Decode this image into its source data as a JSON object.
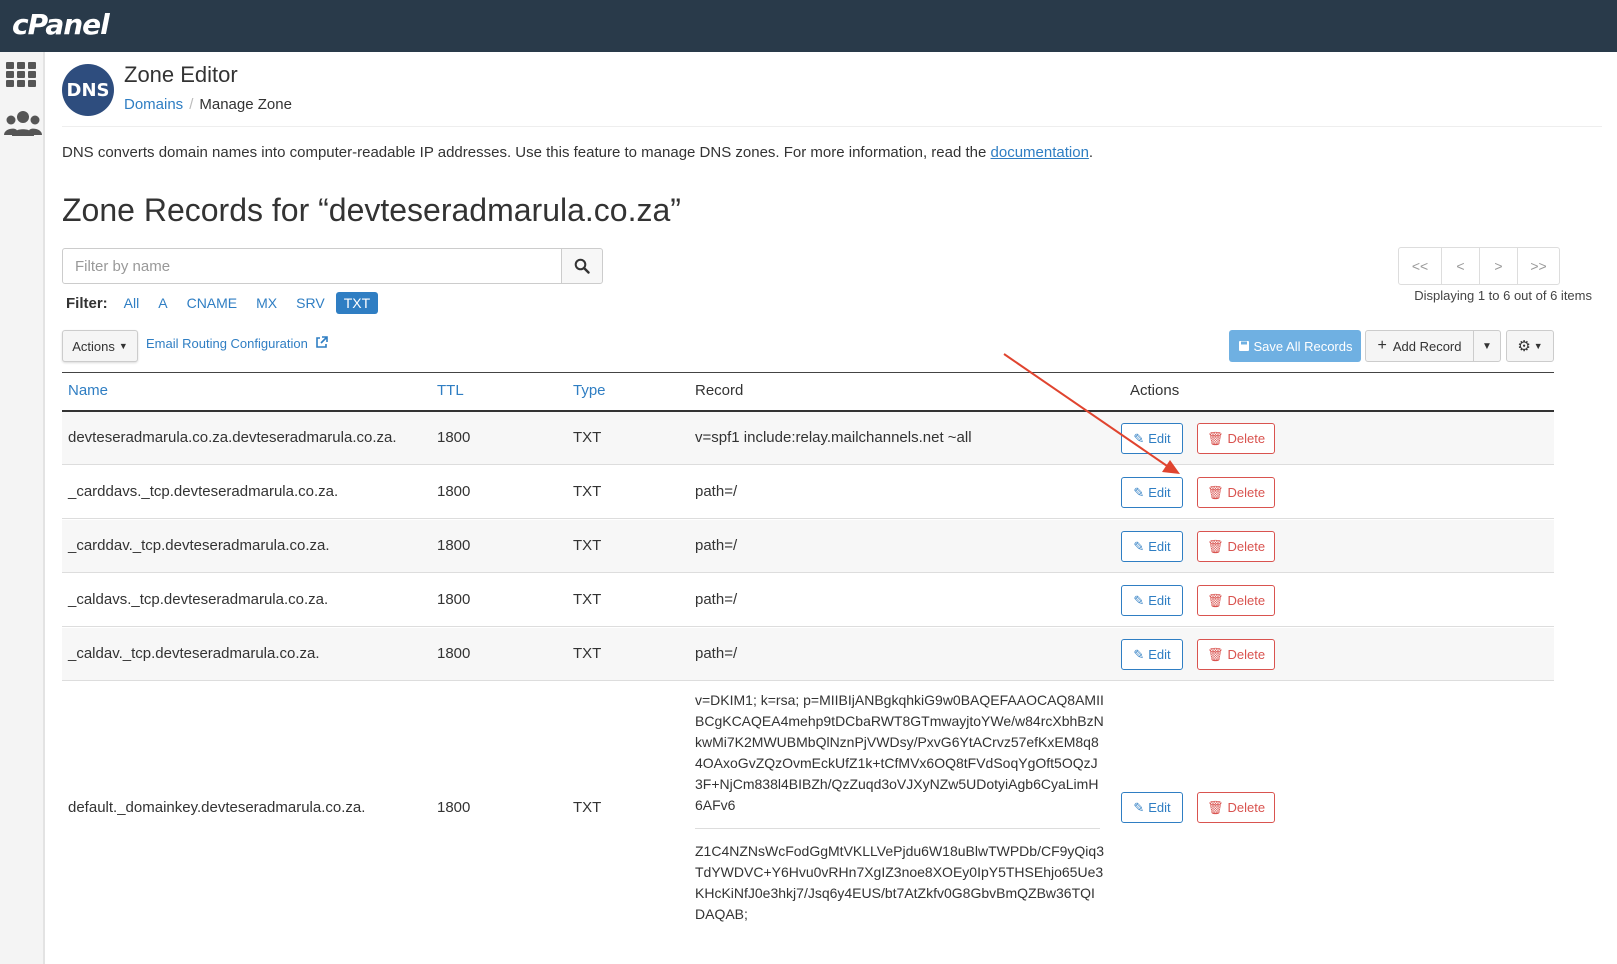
{
  "brand": {
    "logo_text": "cPanel"
  },
  "header": {
    "app_title": "Zone Editor",
    "dns_logo_text": "DNS",
    "breadcrumb": {
      "link": "Domains",
      "separator": "/",
      "current": "Manage Zone"
    }
  },
  "intro": {
    "text": "DNS converts domain names into computer-readable IP addresses. Use this feature to manage DNS zones. For more information, read the ",
    "link": "documentation",
    "suffix": "."
  },
  "zone_title": "Zone Records for “devteseradmarula.co.za”",
  "search": {
    "placeholder": "Filter by name"
  },
  "filter": {
    "label": "Filter:",
    "options": [
      "All",
      "A",
      "CNAME",
      "MX",
      "SRV",
      "TXT"
    ],
    "active": "TXT"
  },
  "pagination": {
    "buttons": [
      "<<",
      "<",
      ">",
      ">>"
    ],
    "info": "Displaying 1 to 6 out of 6 items"
  },
  "toolbar": {
    "actions_label": "Actions",
    "email_routing": "Email Routing Configuration",
    "save_all": "Save All Records",
    "add_record": "Add Record"
  },
  "table": {
    "headers": {
      "name": "Name",
      "ttl": "TTL",
      "type": "Type",
      "record": "Record",
      "actions": "Actions"
    },
    "edit_label": "Edit",
    "delete_label": "Delete",
    "rows": [
      {
        "name": "devteseradmarula.co.za.devteseradmarula.co.za.",
        "ttl": "1800",
        "type": "TXT",
        "record": "v=spf1 include:relay.mailchannels.net ~all"
      },
      {
        "name": "_carddavs._tcp.devteseradmarula.co.za.",
        "ttl": "1800",
        "type": "TXT",
        "record": "path=/"
      },
      {
        "name": "_carddav._tcp.devteseradmarula.co.za.",
        "ttl": "1800",
        "type": "TXT",
        "record": "path=/"
      },
      {
        "name": "_caldavs._tcp.devteseradmarula.co.za.",
        "ttl": "1800",
        "type": "TXT",
        "record": "path=/"
      },
      {
        "name": "_caldav._tcp.devteseradmarula.co.za.",
        "ttl": "1800",
        "type": "TXT",
        "record": "path=/"
      },
      {
        "name": "default._domainkey.devteseradmarula.co.za.",
        "ttl": "1800",
        "type": "TXT",
        "record_part1": "v=DKIM1; k=rsa; p=MIIBIjANBgkqhkiG9w0BAQEFAAOCAQ8AMIIBCgKCAQEA4mehp9tDCbaRWT8GTmwayjtoYWe/w84rcXbhBzNkwMi7K2MWUBMbQlNznPjVWDsy/PxvG6YtACrvz57efKxEM8q84OAxoGvZQzOvmEckUfZ1k+tCfMVx6OQ8tFVdSoqYgOft5OQzJ3F+NjCm838l4BIBZh/QzZuqd3oVJXyNZw5UDotyiAgb6CyaLimH6AFv6",
        "record_part2": "Z1C4NZNsWcFodGgMtVKLLVePjdu6W18uBlwTWPDb/CF9yQiq3TdYWDVC+Y6Hvu0vRHn7XgIZ3noe8XOEy0IpY5THSEhjo65Ue3KHcKiNfJ0e3hkj7/Jsq6y4EUS/bt7AtZkfv0G8GbvBmQZBw36TQIDAQAB;"
      }
    ]
  },
  "colors": {
    "topbar": "#293a4a",
    "link": "#2f7ec3",
    "danger": "#d9534f",
    "save_button": "#6fb0e2",
    "annotation_arrow": "#e0442f"
  }
}
